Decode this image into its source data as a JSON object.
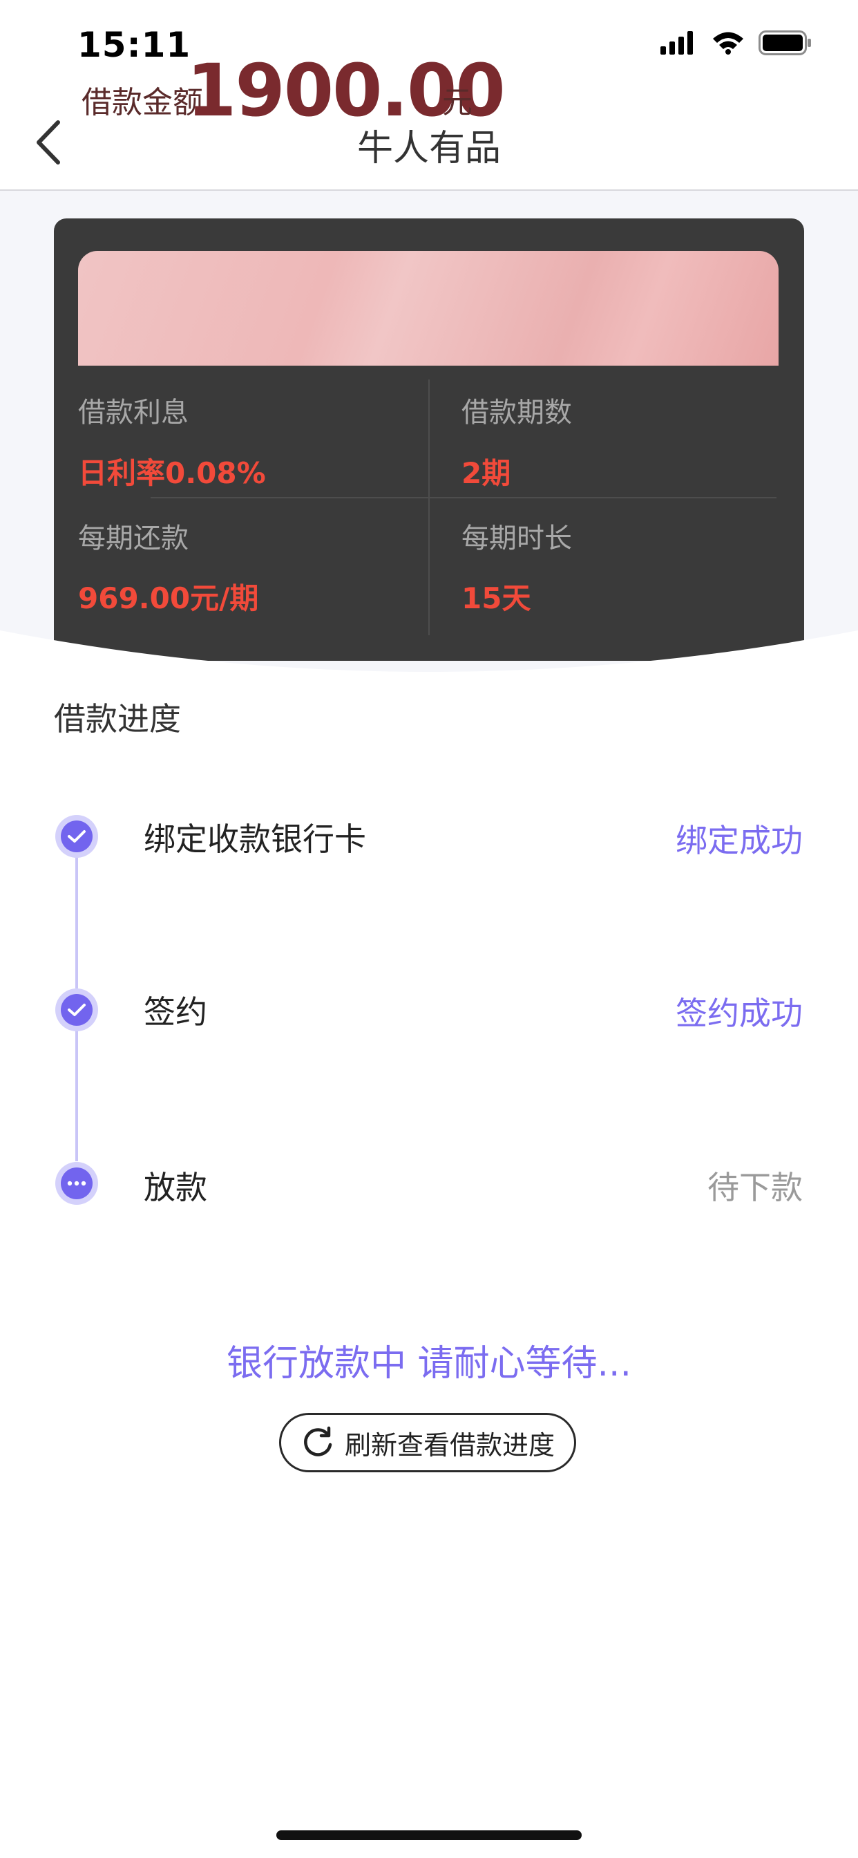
{
  "status_bar": {
    "time": "15:11"
  },
  "nav": {
    "title": "牛人有品"
  },
  "loan": {
    "amount_label": "借款金额",
    "amount_value": "1900.00",
    "amount_unit": "元",
    "interest_label": "借款利息",
    "interest_value": "日利率0.08%",
    "periods_label": "借款期数",
    "periods_value": "2期",
    "repayment_label": "每期还款",
    "repayment_value": "969.00元/期",
    "duration_label": "每期时长",
    "duration_value": "15天"
  },
  "progress": {
    "title": "借款进度",
    "steps": [
      {
        "name": "绑定收款银行卡",
        "status": "绑定成功",
        "state": "done",
        "icon": "check-icon"
      },
      {
        "name": "签约",
        "status": "签约成功",
        "state": "done",
        "icon": "check-icon"
      },
      {
        "name": "放款",
        "status": "待下款",
        "state": "pending",
        "icon": "more-dots-icon"
      }
    ]
  },
  "waiting_text": "银行放款中 请耐心等待...",
  "refresh_button": {
    "label": "刷新查看借款进度",
    "icon": "refresh-icon"
  },
  "colors": {
    "accent": "#7264ee",
    "highlight_red": "#f24a3a",
    "card_bg": "#3a3a3a"
  }
}
